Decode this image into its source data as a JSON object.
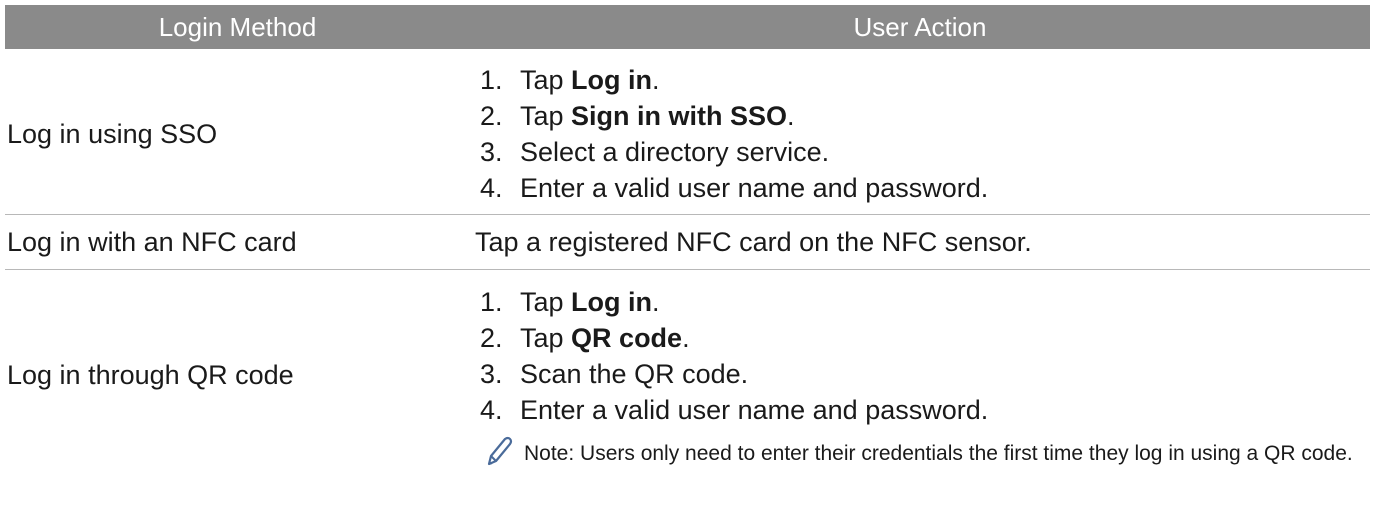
{
  "table": {
    "headers": [
      "Login Method",
      "User Action"
    ],
    "rows": [
      {
        "method": "Log in using SSO",
        "steps": [
          {
            "num": "1.",
            "pre": "Tap ",
            "bold": "Log in",
            "post": "."
          },
          {
            "num": "2.",
            "pre": "Tap ",
            "bold": "Sign in with SSO",
            "post": "."
          },
          {
            "num": "3.",
            "pre": "Select a directory service.",
            "bold": "",
            "post": ""
          },
          {
            "num": "4.",
            "pre": "Enter a valid user name and password.",
            "bold": "",
            "post": ""
          }
        ]
      },
      {
        "method": "Log in with an NFC card",
        "action": "Tap a registered NFC card on the NFC sensor."
      },
      {
        "method": "Log in through QR code",
        "steps": [
          {
            "num": "1.",
            "pre": "Tap ",
            "bold": "Log in",
            "post": "."
          },
          {
            "num": "2.",
            "pre": "Tap ",
            "bold": "QR code",
            "post": "."
          },
          {
            "num": "3.",
            "pre": "Scan the QR code.",
            "bold": "",
            "post": ""
          },
          {
            "num": "4.",
            "pre": "Enter a valid user name and password.",
            "bold": "",
            "post": ""
          }
        ],
        "note": "Note: Users only need to enter their credentials the first time they log in using a QR code.",
        "note_icon": "pencil-icon"
      }
    ]
  },
  "colors": {
    "header_bg": "#8a8a8a",
    "header_text": "#ffffff",
    "divider": "#b8b8b8",
    "icon": "#4a6b9a"
  }
}
